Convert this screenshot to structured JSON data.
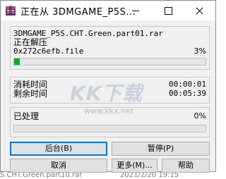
{
  "window": {
    "title": "正在从 3DMGAME_P5S..."
  },
  "archive": {
    "name": "3DMGAME_P5S.CHT.Green.part01.rar",
    "action": "正在解压",
    "current_file": "0x272c6efb.file",
    "file_percent": "3%",
    "file_progress": 0.03
  },
  "timing": {
    "elapsed_label": "消耗时间",
    "elapsed_value": "00:00:01",
    "remaining_label": "剩余时间",
    "remaining_value": "00:05:39"
  },
  "processed": {
    "label": "已处理",
    "percent": "0%",
    "progress": 0.0
  },
  "watermark": {
    "brand": "KK下载",
    "url": "www.kkx.net"
  },
  "buttons": {
    "background": "后台(B)",
    "pause": "暂停(P)",
    "cancel": "取消",
    "more": "更多(M)...",
    "help": "帮助"
  },
  "background_list": {
    "left": "S.CHT.Green.part10.rar",
    "right": "2021/2/20 19:15"
  },
  "colors": {
    "progress_fill": "#06b025",
    "focus_border": "#0078d7"
  },
  "icons": [
    "winrar-app-icon",
    "minimize-icon",
    "maximize-icon",
    "close-icon"
  ]
}
